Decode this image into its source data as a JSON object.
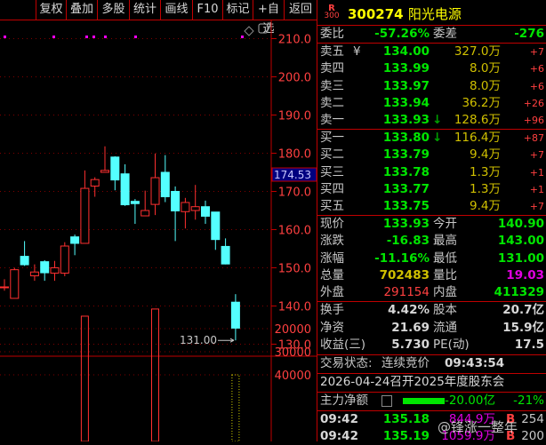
{
  "toolbar": [
    "复权",
    "叠加",
    "多股",
    "统计",
    "画线",
    "F10",
    "标记",
    "+自选",
    "返回"
  ],
  "chart": {
    "price_axis": [
      "210.0",
      "200.0",
      "190.0",
      "180.0",
      "170.0",
      "160.0",
      "150.0",
      "140.0",
      "130.0"
    ],
    "price_ticks": [
      210,
      200,
      190,
      180,
      170,
      160,
      150,
      140,
      130
    ],
    "crosshair_price": "174.53",
    "low_label": "131.00",
    "volume_axis": [
      "40000",
      "30000",
      "20000"
    ],
    "volume_ticks": [
      40000,
      30000,
      20000
    ],
    "up_color": "#ff3030",
    "down_color": "#54ffff",
    "candles": [
      [
        145,
        147,
        144,
        145
      ],
      [
        142,
        150,
        142,
        149.5
      ],
      [
        153,
        157,
        150.5,
        150.8
      ],
      [
        147.9,
        150.9,
        146.6,
        148.9
      ],
      [
        151.6,
        152,
        146.6,
        148.7
      ],
      [
        148.6,
        151.8,
        146.6,
        150
      ],
      [
        148.6,
        156.7,
        147.8,
        155.7
      ],
      [
        158.1,
        158.7,
        153.3,
        156.4
      ],
      [
        156.4,
        175.5,
        156.4,
        170.8
      ],
      [
        171.4,
        173.7,
        168.6,
        173.1
      ],
      [
        175,
        181.8,
        175,
        175.5
      ],
      [
        179,
        179.2,
        170.3,
        173
      ],
      [
        174.6,
        177.1,
        166.2,
        166.5
      ],
      [
        167.4,
        168,
        161.5,
        166.8
      ],
      [
        163.6,
        170.2,
        163.6,
        165
      ],
      [
        166.6,
        179.9,
        163.8,
        173.6
      ],
      [
        175,
        179.5,
        167.2,
        168.6
      ],
      [
        170,
        171.3,
        157,
        164.9
      ],
      [
        164.7,
        168.3,
        160.3,
        167.1
      ],
      [
        165,
        171.7,
        162.6,
        166
      ],
      [
        166,
        167.6,
        161.5,
        163.5
      ],
      [
        164.6,
        164.6,
        154.7,
        157.4
      ],
      [
        155.6,
        157.7,
        150.9,
        151
      ],
      [
        141,
        143.1,
        131,
        134.2
      ]
    ],
    "volumes": {
      "8": 14600,
      "15": 11500,
      "23": 40000
    }
  },
  "stock": {
    "badge_top": "R",
    "badge_bottom": "300",
    "code": "300274",
    "name": "阳光电源"
  },
  "weibi": {
    "label": "委比",
    "value": "-57.26%",
    "diff_label": "委差",
    "diff": "-276"
  },
  "sell": [
    {
      "label": "卖五",
      "price": "134.00",
      "vol": "327.0万",
      "chg": "+7",
      "mark": "¥"
    },
    {
      "label": "卖四",
      "price": "133.99",
      "vol": "8.0万",
      "chg": "+6"
    },
    {
      "label": "卖三",
      "price": "133.97",
      "vol": "8.0万",
      "chg": "+6"
    },
    {
      "label": "卖二",
      "price": "133.94",
      "vol": "36.2万",
      "chg": "+26"
    },
    {
      "label": "卖一",
      "price": "133.93",
      "vol": "128.6万",
      "chg": "+96",
      "mark": "↓"
    }
  ],
  "buy": [
    {
      "label": "买一",
      "price": "133.80",
      "vol": "116.4万",
      "chg": "+87",
      "mark": "↓"
    },
    {
      "label": "买二",
      "price": "133.79",
      "vol": "9.4万",
      "chg": "+7"
    },
    {
      "label": "买三",
      "price": "133.78",
      "vol": "1.3万",
      "chg": "+1"
    },
    {
      "label": "买四",
      "price": "133.77",
      "vol": "1.3万",
      "chg": "+1"
    },
    {
      "label": "买五",
      "price": "133.75",
      "vol": "9.4万",
      "chg": "+7"
    }
  ],
  "quote": [
    {
      "l1": "现价",
      "v1": "133.93",
      "c1": "g",
      "l2": "今开",
      "v2": "140.90",
      "c2": "g"
    },
    {
      "l1": "涨跌",
      "v1": "-16.83",
      "c1": "g",
      "l2": "最高",
      "v2": "143.00",
      "c2": "g"
    },
    {
      "l1": "涨幅",
      "v1": "-11.16%",
      "c1": "g",
      "l2": "最低",
      "v2": "131.00",
      "c2": "g"
    },
    {
      "l1": "总量",
      "v1": "702483",
      "c1": "y",
      "l2": "量比",
      "v2": "19.03",
      "c2": "m"
    },
    {
      "l1": "外盘",
      "v1": "291154",
      "c1": "r",
      "l2": "内盘",
      "v2": "411329",
      "c2": "g"
    }
  ],
  "fund": [
    {
      "l1": "换手",
      "v1": "4.42%",
      "l2": "股本",
      "v2": "20.7亿"
    },
    {
      "l1": "净资",
      "v1": "21.69",
      "l2": "流通",
      "v2": "15.9亿"
    },
    {
      "l1": "收益(三)",
      "v1": "5.730",
      "l2": "PE(动)",
      "v2": "17.5"
    }
  ],
  "status": {
    "label": "交易状态:",
    "value": "连续竞价",
    "time": "09:43:54"
  },
  "notice": "2026-04-24召开2025年度股东会",
  "mainflow": {
    "label": "主力净额",
    "value": "-20.00亿",
    "pct": "-21%"
  },
  "ticks": [
    {
      "time": "09:42",
      "price": "135.18",
      "vol": "844.9万",
      "side": "B",
      "n": "254"
    },
    {
      "time": "09:42",
      "price": "135.19",
      "vol": "1059.9万",
      "side": "B",
      "n": "200"
    }
  ],
  "watermark": "@锋涨一整年"
}
